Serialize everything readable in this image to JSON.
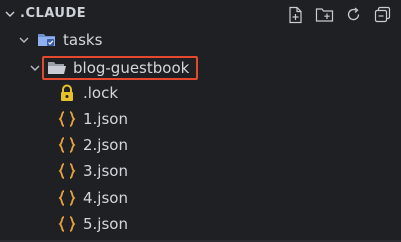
{
  "explorer": {
    "title": ".CLAUDE",
    "actions": [
      {
        "name": "new-file-icon"
      },
      {
        "name": "new-folder-icon"
      },
      {
        "name": "refresh-icon"
      },
      {
        "name": "collapse-all-icon"
      }
    ]
  },
  "tree": {
    "tasks_label": "tasks",
    "blog_label": "blog-guestbook",
    "files": [
      {
        "label": ".lock",
        "icon": "lock-icon"
      },
      {
        "label": "1.json",
        "icon": "json-icon"
      },
      {
        "label": "2.json",
        "icon": "json-icon"
      },
      {
        "label": "3.json",
        "icon": "json-icon"
      },
      {
        "label": "4.json",
        "icon": "json-icon"
      },
      {
        "label": "5.json",
        "icon": "json-icon"
      }
    ]
  },
  "colors": {
    "background": "#1f2024",
    "highlight_border": "#e4482d",
    "json_icon": "#e8a33d",
    "lock_icon": "#e7c12b",
    "folder_icon": "#7fa2e0"
  }
}
